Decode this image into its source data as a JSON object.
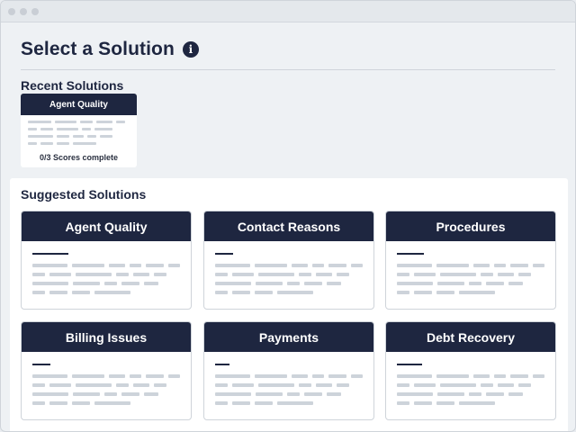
{
  "page": {
    "title": "Select a Solution",
    "info_icon": "info-icon"
  },
  "recent": {
    "title": "Recent Solutions",
    "cards": [
      {
        "label": "Agent Quality",
        "status": "0/3 Scores complete"
      }
    ]
  },
  "suggested": {
    "title": "Suggested Solutions",
    "cards": [
      {
        "label": "Agent Quality"
      },
      {
        "label": "Contact Reasons"
      },
      {
        "label": "Procedures"
      },
      {
        "label": "Billing Issues"
      },
      {
        "label": "Payments"
      },
      {
        "label": "Debt Recovery"
      }
    ]
  },
  "colors": {
    "header_navy": "#1e2640",
    "placeholder_gray": "#cdd3da",
    "background": "#eef1f4"
  }
}
